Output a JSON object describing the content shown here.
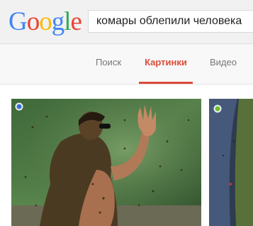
{
  "brand": {
    "logo_letters": [
      "G",
      "o",
      "o",
      "g",
      "l",
      "e"
    ],
    "logo_colors": [
      "#4285f4",
      "#ea4335",
      "#fbbc05",
      "#4285f4",
      "#34a853",
      "#ea4335"
    ]
  },
  "search": {
    "query": "комары облепили человека"
  },
  "tabs": [
    {
      "label": "Поиск",
      "active": false
    },
    {
      "label": "Картинки",
      "active": true
    },
    {
      "label": "Видео",
      "active": false
    }
  ],
  "colors": {
    "accent": "#dd4b39",
    "tab_inactive": "#777777",
    "header_bg": "#f1f1f1"
  },
  "results": {
    "images": [
      {
        "badge_color": "#3a6fd8"
      },
      {
        "badge_color": "#6cbf2a"
      }
    ]
  }
}
